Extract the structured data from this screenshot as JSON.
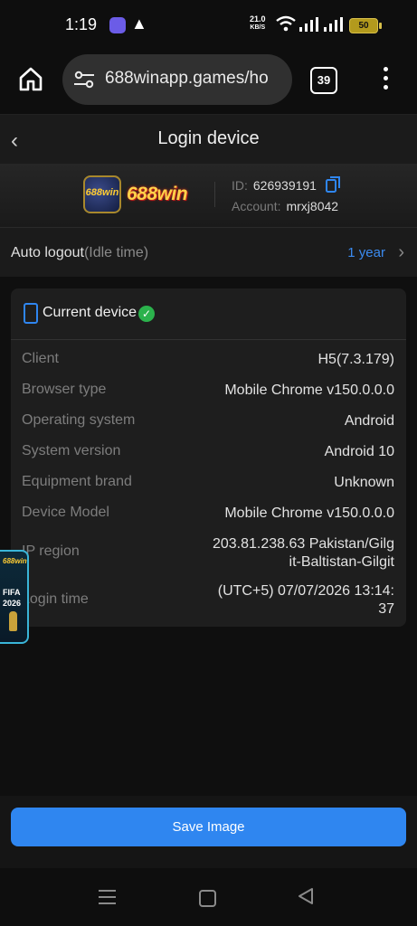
{
  "status": {
    "time": "1:19",
    "speed_value": "21.0",
    "speed_unit": "KB/S",
    "battery": "50"
  },
  "browser": {
    "url": "688winapp.games/ho",
    "tab_count": "39"
  },
  "header": {
    "title": "Login device"
  },
  "account": {
    "id_label": "ID:",
    "id_value": "626939191",
    "account_label": "Account:",
    "account_value": "mrxj8042",
    "logo_badge": "688win",
    "logo_word": "688win"
  },
  "auto_logout": {
    "label": "Auto logout",
    "sub_label": "(Idle time)",
    "value": "1 year"
  },
  "device": {
    "title": "Current device",
    "rows": [
      {
        "key": "Client",
        "value": "H5(7.3.179)"
      },
      {
        "key": "Browser type",
        "value": "Mobile Chrome v150.0.0.0"
      },
      {
        "key": "Operating system",
        "value": "Android"
      },
      {
        "key": "System version",
        "value": "Android 10"
      },
      {
        "key": "Equipment brand",
        "value": "Unknown"
      },
      {
        "key": "Device Model",
        "value": "Mobile Chrome v150.0.0.0"
      },
      {
        "key": "IP region",
        "value_line1": "203.81.238.63 Pakistan/Gilg",
        "value_line2": "it-Baltistan-Gilgit"
      },
      {
        "key": "Login time",
        "value_line1": "(UTC+5)  07/07/2026 13:14:",
        "value_line2": "37"
      }
    ]
  },
  "promo": {
    "brand": "688win",
    "line1": "FIFA",
    "line2": "2026"
  },
  "actions": {
    "save_label": "Save Image"
  },
  "colors": {
    "accent": "#2f86f0",
    "success": "#2bb24c",
    "background": "#0f0f0f"
  }
}
